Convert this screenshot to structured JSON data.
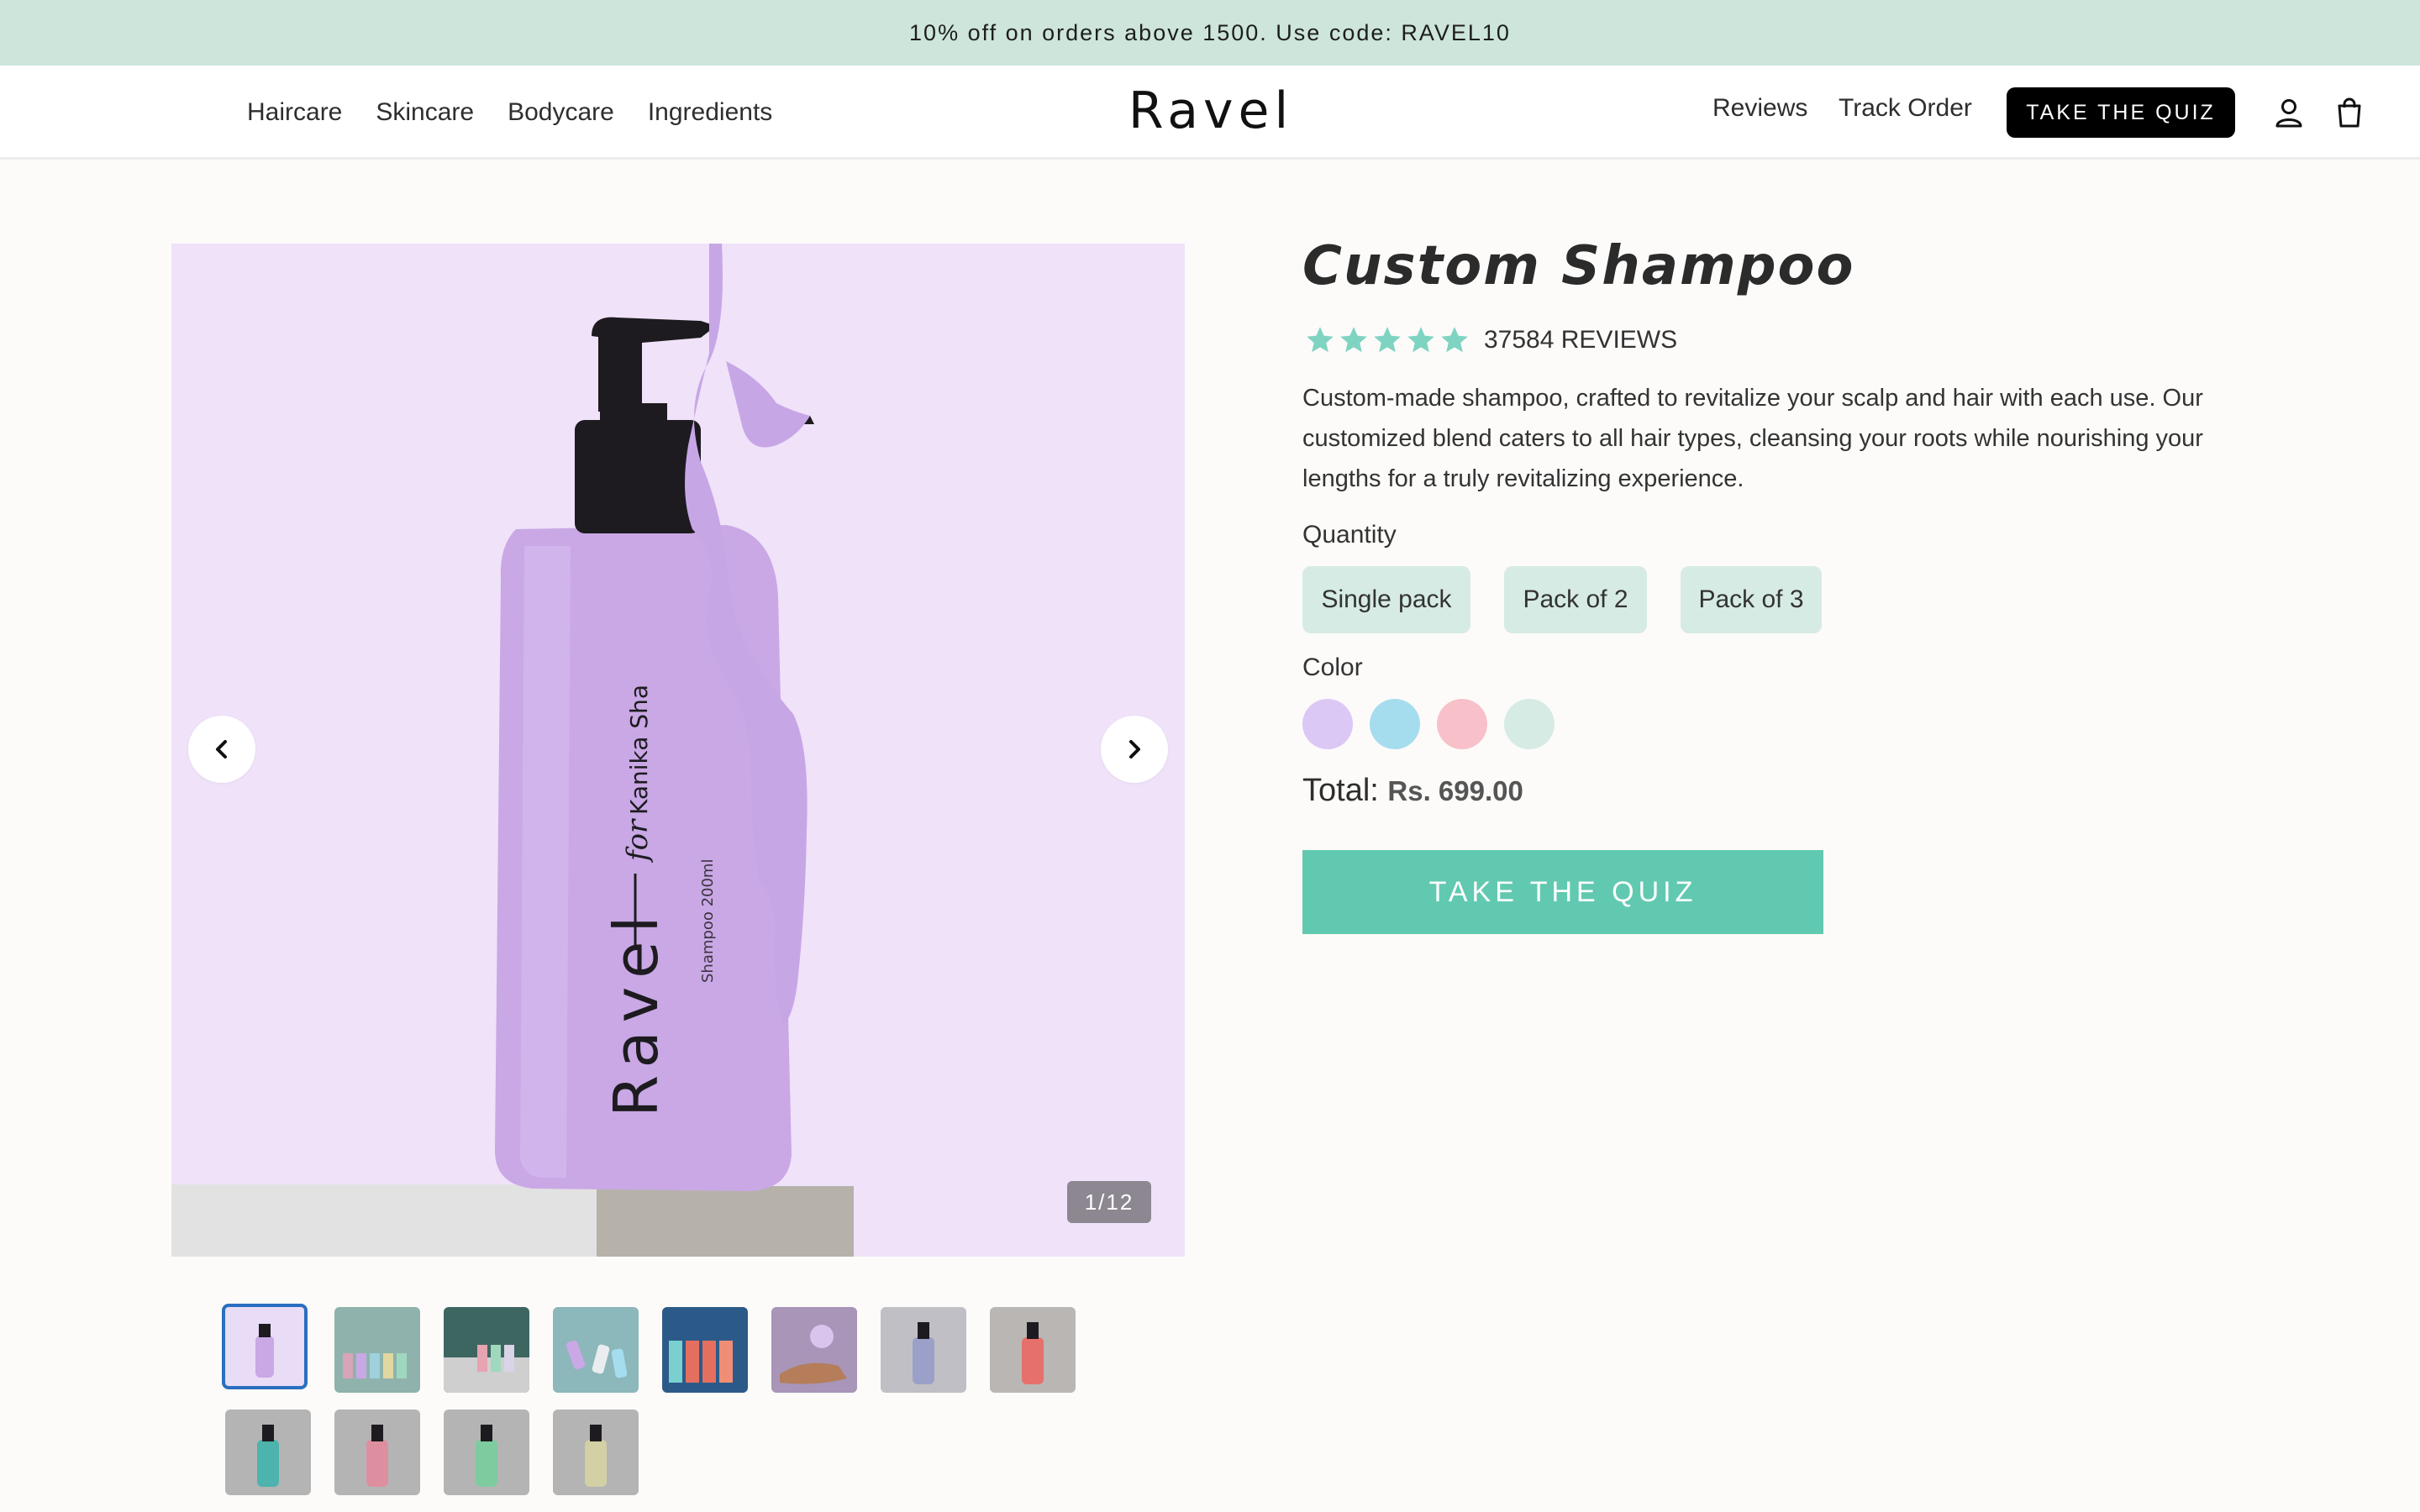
{
  "announcement": "10% off on orders above 1500. Use code: RAVEL10",
  "header": {
    "nav_left": [
      "Haircare",
      "Skincare",
      "Bodycare",
      "Ingredients"
    ],
    "logo": "Ravel",
    "reviews_link": "Reviews",
    "track_order_link": "Track Order",
    "quiz_button": "TAKE THE QUIZ",
    "icons": [
      "user-icon",
      "shopping-bag-icon"
    ]
  },
  "gallery": {
    "counter": "1/12",
    "bottle_brand": "Ravel",
    "bottle_for": "for",
    "bottle_name": "Kanika Sha",
    "bottle_volume": "Shampoo 200ml",
    "thumbnail_count": 12
  },
  "product": {
    "title": "Custom Shampoo",
    "rating_stars": 5,
    "reviews": "37584 REVIEWS",
    "description": "Custom-made shampoo, crafted to revitalize your scalp and hair with each use. Our customized blend caters to all hair types, cleansing your roots while nourishing your lengths for a truly revitalizing experience.",
    "quantity_label": "Quantity",
    "quantity_options": [
      "Single pack",
      "Pack of 2",
      "Pack of 3"
    ],
    "color_label": "Color",
    "colors": [
      "#dcc8f5",
      "#a6ddee",
      "#f8c1c9",
      "#d6ebe4"
    ],
    "total_label": "Total:",
    "total_value": "Rs. 699.00",
    "cta": "TAKE THE QUIZ"
  },
  "theme": {
    "accent": "#62c9b1",
    "announcement_bg": "#cde5da",
    "star_color": "#7fd4c1"
  }
}
